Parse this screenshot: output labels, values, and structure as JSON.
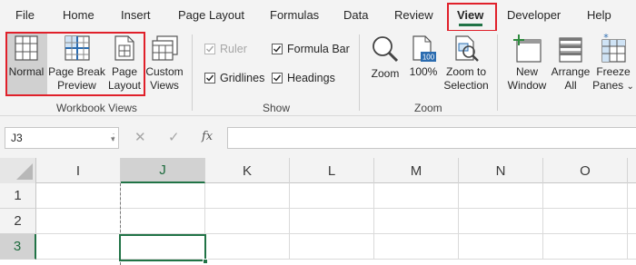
{
  "tabs": [
    {
      "label": "File",
      "active": false
    },
    {
      "label": "Home",
      "active": false
    },
    {
      "label": "Insert",
      "active": false
    },
    {
      "label": "Page Layout",
      "active": false
    },
    {
      "label": "Formulas",
      "active": false
    },
    {
      "label": "Data",
      "active": false
    },
    {
      "label": "Review",
      "active": false
    },
    {
      "label": "View",
      "active": true
    },
    {
      "label": "Developer",
      "active": false
    },
    {
      "label": "Help",
      "active": false
    }
  ],
  "ribbon": {
    "workbook_views": {
      "group_label": "Workbook Views",
      "normal": {
        "label": "Normal",
        "selected": true,
        "icon": "normal-view-icon"
      },
      "page_break_preview": {
        "line1": "Page Break",
        "line2": "Preview",
        "icon": "page-break-preview-icon"
      },
      "page_layout": {
        "line1": "Page",
        "line2": "Layout",
        "icon": "page-layout-icon"
      },
      "custom_views": {
        "line1": "Custom",
        "line2": "Views",
        "icon": "custom-views-icon"
      }
    },
    "show": {
      "group_label": "Show",
      "ruler": {
        "label": "Ruler",
        "checked": true,
        "disabled": true
      },
      "gridlines": {
        "label": "Gridlines",
        "checked": true
      },
      "formula_bar": {
        "label": "Formula Bar",
        "checked": true
      },
      "headings": {
        "label": "Headings",
        "checked": true
      }
    },
    "zoom": {
      "group_label": "Zoom",
      "zoom": {
        "label": "Zoom",
        "icon": "magnifier-icon"
      },
      "hundred": {
        "label": "100%",
        "badge": "100",
        "icon": "zoom-100-icon"
      },
      "zoom_to_selection": {
        "line1": "Zoom to",
        "line2": "Selection",
        "icon": "zoom-selection-icon"
      }
    },
    "window": {
      "new_window": {
        "line1": "New",
        "line2": "Window",
        "icon": "new-window-icon"
      },
      "arrange_all": {
        "line1": "Arrange",
        "line2": "All",
        "icon": "arrange-all-icon"
      },
      "freeze_panes": {
        "line1": "Freeze",
        "line2": "Panes",
        "dropdown": "⌄",
        "icon": "freeze-panes-icon"
      }
    }
  },
  "formula_bar": {
    "name_box": "J3",
    "cancel_glyph": "✕",
    "enter_glyph": "✓",
    "fx_label": "fx",
    "formula": ""
  },
  "grid": {
    "columns": [
      "I",
      "J",
      "K",
      "L",
      "M",
      "N",
      "O"
    ],
    "selected_column": "J",
    "rows": [
      "1",
      "2",
      "3"
    ],
    "selected_row": "3",
    "active_cell": "J3"
  },
  "colors": {
    "accent_green": "#217346",
    "highlight_red": "#e0202a",
    "ribbon_bg": "#f3f3f3"
  }
}
